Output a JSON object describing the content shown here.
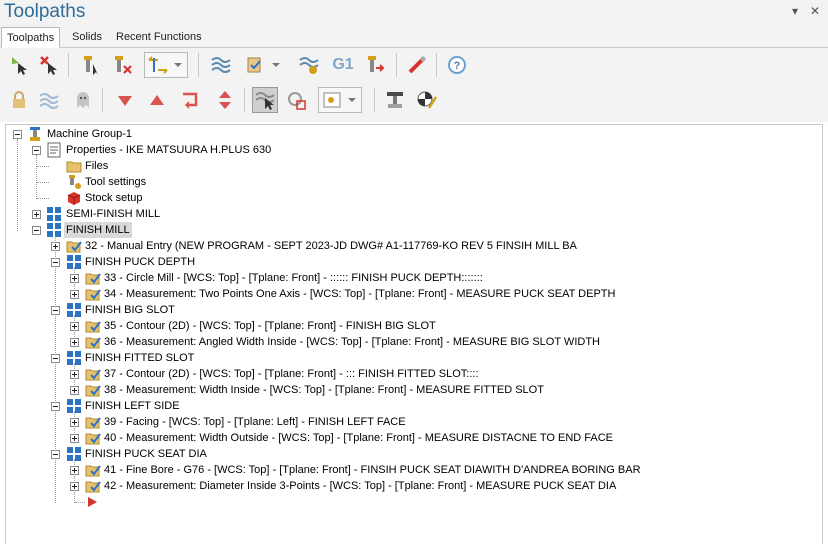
{
  "window": {
    "title": "Toolpaths",
    "pin_glyph": "▾",
    "close_glyph": "✕"
  },
  "tabs": [
    {
      "label": "Toolpaths",
      "active": true
    },
    {
      "label": "Solids",
      "active": false
    },
    {
      "label": "Recent Functions",
      "active": false
    }
  ],
  "toolbar": {
    "g1_label": "G1"
  },
  "tree": {
    "machine_group": "Machine Group-1",
    "properties": "Properties - IKE MATSUURA H.PLUS 630",
    "files": "Files",
    "tool_settings": "Tool settings",
    "stock_setup": "Stock setup",
    "semi_finish": "SEMI-FINISH MILL",
    "finish_mill": "FINISH MILL",
    "op32": "32 - Manual Entry (NEW PROGRAM - SEPT 2023-JD DWG# A1-117769-KO REV 5 FINSIH MILL BA",
    "grp_puck_depth": "FINISH PUCK DEPTH",
    "op33": "33 - Circle Mill - [WCS: Top] - [Tplane: Front] - :::::: FINISH PUCK DEPTH:::::::",
    "op34": "34 - Measurement: Two Points One Axis - [WCS: Top] - [Tplane: Front] - MEASURE PUCK SEAT DEPTH",
    "grp_big_slot": "FINISH BIG SLOT",
    "op35": "35 - Contour (2D) - [WCS: Top] - [Tplane: Front] - FINISH BIG SLOT",
    "op36": "36 - Measurement: Angled Width Inside - [WCS: Top] - [Tplane: Front] - MEASURE BIG SLOT WIDTH",
    "grp_fitted_slot": "FINISH FITTED SLOT",
    "op37": "37 - Contour (2D) - [WCS: Top] - [Tplane: Front] - ::: FINISH FITTED SLOT::::",
    "op38": "38 - Measurement: Width Inside - [WCS: Top] - [Tplane: Front] - MEASURE FITTED SLOT",
    "grp_left_side": "FINISH LEFT SIDE",
    "op39": "39 - Facing - [WCS: Top] - [Tplane: Left] - FINISH LEFT FACE",
    "op40": "40 - Measurement: Width Outside - [WCS: Top] - [Tplane: Front] - MEASURE DISTACNE TO END FACE",
    "grp_seat_dia": "FINISH PUCK SEAT DIA",
    "op41": "41 - Fine Bore - G76 - [WCS: Top] - [Tplane: Front] - FINSIH PUCK SEAT DIAWITH D'ANDREA BORING BAR",
    "op42": "42 - Measurement: Diameter Inside 3-Points - [WCS: Top] - [Tplane: Front] - MEASURE PUCK SEAT DIA"
  },
  "colors": {
    "title": "#2f6d98",
    "accent_blue": "#2b74c4",
    "insert_arrow": "#d9342b"
  }
}
